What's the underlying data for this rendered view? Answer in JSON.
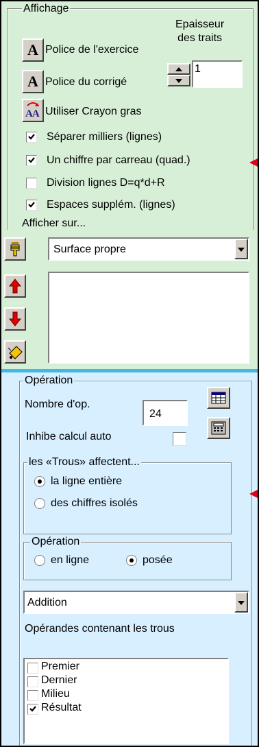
{
  "affichage": {
    "legend": "Affichage",
    "epaisseur_label_line1": "Epaisseur",
    "epaisseur_label_line2": "des traits",
    "police_exercice_icon_text": "A",
    "police_exercice_label": "Police de l'exercice",
    "police_corrige_icon_text": "A",
    "police_corrige_label": "Police du corrigé",
    "epaisseur_value": "1",
    "crayon_icon_text": "AA",
    "crayon_label": "Utiliser Crayon gras",
    "checkboxes": [
      {
        "label": "Séparer milliers (lignes)",
        "checked": true
      },
      {
        "label": "Un chiffre par carreau (quad.)",
        "checked": true
      },
      {
        "label": "Division lignes D=q*d+R",
        "checked": false
      },
      {
        "label": "Espaces supplém. (lignes)",
        "checked": true
      }
    ],
    "afficher_sur_label": "Afficher sur...",
    "surface_selected": "Surface propre"
  },
  "operation": {
    "legend": "Opération",
    "nombre_label": "Nombre d'op.",
    "nombre_value": "24",
    "inhibe_label": "Inhibe calcul auto",
    "trous_group": {
      "legend": "les «Trous» affectent...",
      "options": [
        {
          "label": "la ligne entière",
          "selected": true
        },
        {
          "label": "des chiffres isolés",
          "selected": false
        }
      ]
    },
    "operation_group": {
      "legend": "Opération",
      "options": [
        {
          "label": "en ligne",
          "selected": false
        },
        {
          "label": "posée",
          "selected": true
        }
      ]
    },
    "type_selected": "Addition",
    "operandes_label": "Opérandes contenant les trous",
    "operandes": [
      {
        "label": "Premier",
        "checked": false
      },
      {
        "label": "Dernier",
        "checked": false
      },
      {
        "label": "Milieu",
        "checked": false
      },
      {
        "label": "Résultat",
        "checked": true
      }
    ]
  },
  "colors": {
    "top_panel": "#d7efd7",
    "bottom_panel": "#d7efff",
    "divider": "#41b8e6",
    "marker": "#e0001a"
  }
}
